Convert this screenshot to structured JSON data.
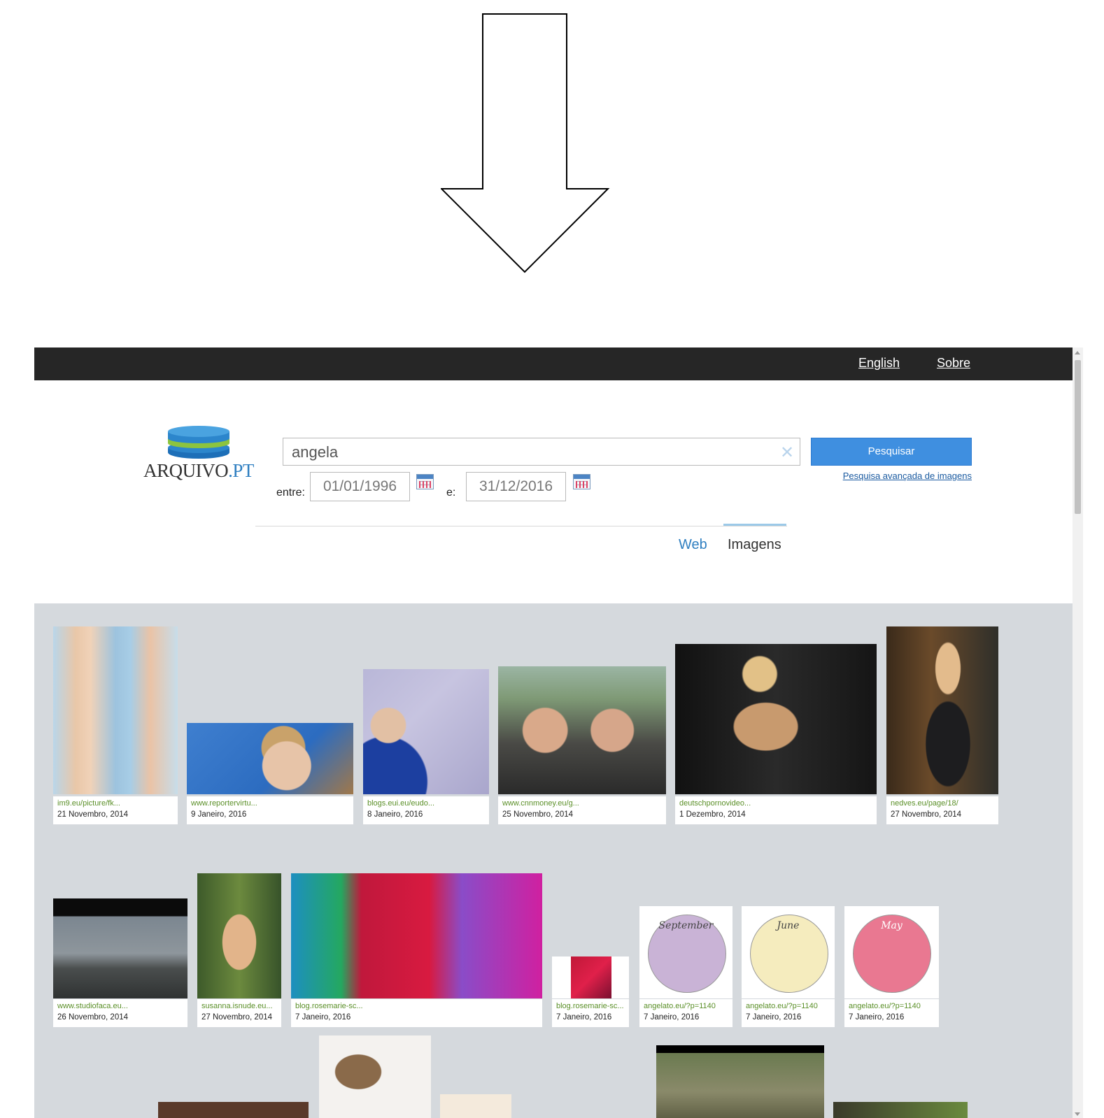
{
  "topbar": {
    "english_label": "English",
    "about_label": "Sobre"
  },
  "logo": {
    "text_main": "ARQUIVO",
    "text_dot_pt": ".PT"
  },
  "search": {
    "value": "angela",
    "button_label": "Pesquisar",
    "advanced_link": "Pesquisa avançada de imagens",
    "between_label": "entre:",
    "and_label": "e:",
    "date_from": "01/01/1996",
    "date_to": "31/12/2016"
  },
  "tabs": {
    "web": "Web",
    "images": "Imagens",
    "active": "Imagens"
  },
  "colors": {
    "accent": "#3f8fe0",
    "topbar": "#262626",
    "results_bg": "#d5d9dd",
    "url_green": "#5a8f27",
    "link_blue": "#2f7fc1"
  },
  "results": [
    {
      "url": "im9.eu/picture/fk...",
      "date": "21 Novembro, 2014"
    },
    {
      "url": "www.reportervirtu...",
      "date": "9 Janeiro, 2016"
    },
    {
      "url": "blogs.eui.eu/eudo...",
      "date": "8 Janeiro, 2016"
    },
    {
      "url": "www.cnnmoney.eu/g...",
      "date": "25 Novembro, 2014"
    },
    {
      "url": "deutschpornovideo...",
      "date": "1 Dezembro, 2014"
    },
    {
      "url": "nedves.eu/page/18/",
      "date": "27 Novembro, 2014"
    },
    {
      "url": "www.studiofaca.eu...",
      "date": "26 Novembro, 2014"
    },
    {
      "url": "susanna.isnude.eu...",
      "date": "27 Novembro, 2014"
    },
    {
      "url": "blog.rosemarie-sc...",
      "date": "7 Janeiro, 2016"
    },
    {
      "url": "blog.rosemarie-sc...",
      "date": "7 Janeiro, 2016"
    },
    {
      "url": "angelato.eu/?p=1140",
      "date": "7 Janeiro, 2016",
      "thumb_text": "September"
    },
    {
      "url": "angelato.eu/?p=1140",
      "date": "7 Janeiro, 2016",
      "thumb_text": "June"
    },
    {
      "url": "angelato.eu/?p=1140",
      "date": "7 Janeiro, 2016",
      "thumb_text": "May"
    }
  ]
}
